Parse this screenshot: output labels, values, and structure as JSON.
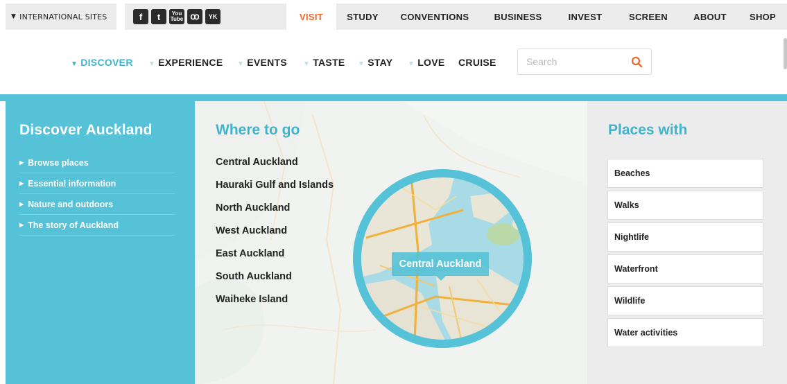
{
  "top_bar": {
    "international_sites": "INTERNATIONAL SITES",
    "social": [
      {
        "icon": "facebook-icon",
        "glyph": "f"
      },
      {
        "icon": "twitter-icon",
        "glyph": "t"
      },
      {
        "icon": "youtube-icon",
        "glyph": "You Tube"
      },
      {
        "icon": "weibo-icon",
        "glyph": "ꝏ"
      },
      {
        "icon": "youku-icon",
        "glyph": "YK"
      }
    ],
    "main_nav": [
      {
        "label": "VISIT",
        "active": true
      },
      {
        "label": "STUDY"
      },
      {
        "label": "CONVENTIONS"
      },
      {
        "label": "BUSINESS"
      },
      {
        "label": "INVEST"
      },
      {
        "label": "SCREEN"
      },
      {
        "label": "ABOUT"
      },
      {
        "label": "SHOP"
      }
    ]
  },
  "sub_nav": {
    "items": [
      {
        "label": "DISCOVER",
        "caret": true,
        "active": true
      },
      {
        "label": "EXPERIENCE",
        "caret": true
      },
      {
        "label": "EVENTS",
        "caret": true
      },
      {
        "label": "TASTE",
        "caret": true
      },
      {
        "label": "STAY",
        "caret": true
      },
      {
        "label": "LOVE",
        "caret": true
      },
      {
        "label": "CRUISE",
        "caret": false
      }
    ],
    "search_placeholder": "Search"
  },
  "discover_panel": {
    "title": "Discover Auckland",
    "links": [
      "Browse places",
      "Essential information",
      "Nature and outdoors",
      "The story of Auckland"
    ]
  },
  "where_to_go": {
    "title": "Where to go",
    "places": [
      "Central Auckland",
      "Hauraki Gulf and Islands",
      "North Auckland",
      "West Auckland",
      "East Auckland",
      "South Auckland",
      "Waiheke Island"
    ],
    "map_label": "Central Auckland"
  },
  "places_with": {
    "title": "Places with",
    "items": [
      "Beaches",
      "Walks",
      "Nightlife",
      "Waterfront",
      "Wildlife",
      "Water activities"
    ]
  },
  "colors": {
    "accent_teal": "#55c2d7",
    "heading_teal": "#3eb4cc",
    "active_orange": "#e8692a"
  }
}
